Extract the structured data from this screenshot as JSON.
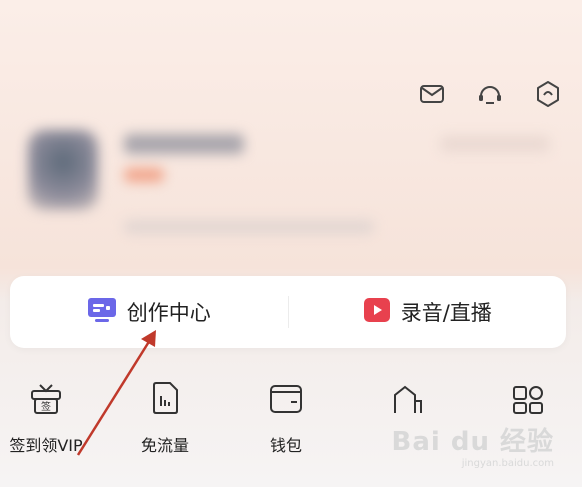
{
  "header": {
    "icons": [
      {
        "name": "mail-icon"
      },
      {
        "name": "headset-icon"
      },
      {
        "name": "settings-icon"
      }
    ]
  },
  "card": {
    "create_label": "创作中心",
    "record_label": "录音/直播",
    "create_icon": "monitor-icon",
    "record_icon": "play-icon"
  },
  "grid": {
    "items": [
      {
        "label": "签到领VIP",
        "icon": "gift-icon"
      },
      {
        "label": "免流量",
        "icon": "sim-card-icon"
      },
      {
        "label": "钱包",
        "icon": "wallet-icon"
      },
      {
        "label": "",
        "icon": "house-icon"
      },
      {
        "label": "",
        "icon": "apps-icon"
      }
    ]
  },
  "watermark": {
    "brand": "Bai du 经验",
    "url": "jingyan.baidu.com"
  },
  "colors": {
    "accent_red": "#e8414e",
    "arrow": "#c0392b",
    "create_icon": "#6b67e8"
  }
}
